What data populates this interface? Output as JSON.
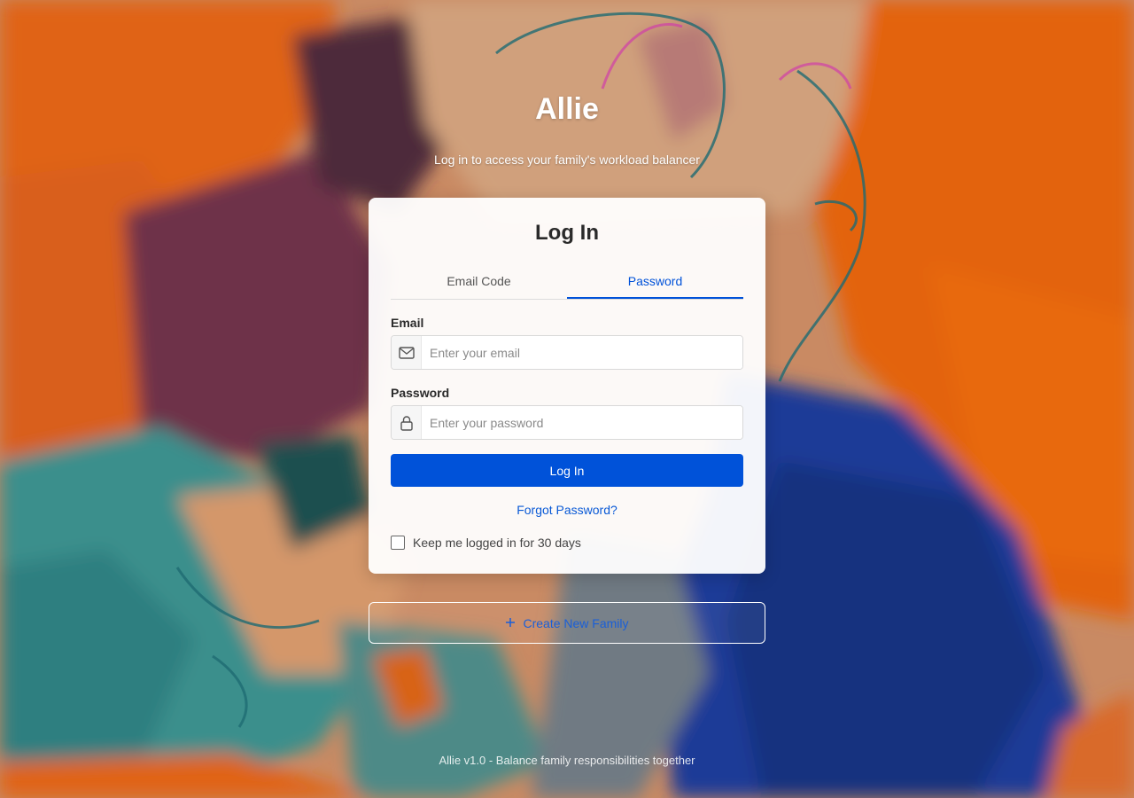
{
  "app": {
    "title": "Allie",
    "subtitle": "Log in to access your family's workload balancer"
  },
  "card": {
    "title": "Log In",
    "tabs": [
      {
        "label": "Email Code",
        "active": false
      },
      {
        "label": "Password",
        "active": true
      }
    ],
    "email": {
      "label": "Email",
      "placeholder": "Enter your email",
      "value": "",
      "icon": "mail-icon"
    },
    "password": {
      "label": "Password",
      "placeholder": "Enter your password",
      "value": "",
      "icon": "lock-icon"
    },
    "login_label": "Log In",
    "forgot_label": "Forgot Password?",
    "keep_logged_label": "Keep me logged in for 30 days",
    "keep_logged_checked": false
  },
  "create_family_label": "Create New Family",
  "create_family_icon": "plus-icon",
  "footer": "Allie v1.0 - Balance family responsibilities together",
  "colors": {
    "accent": "#0052d9",
    "link": "#0a5ad6"
  }
}
